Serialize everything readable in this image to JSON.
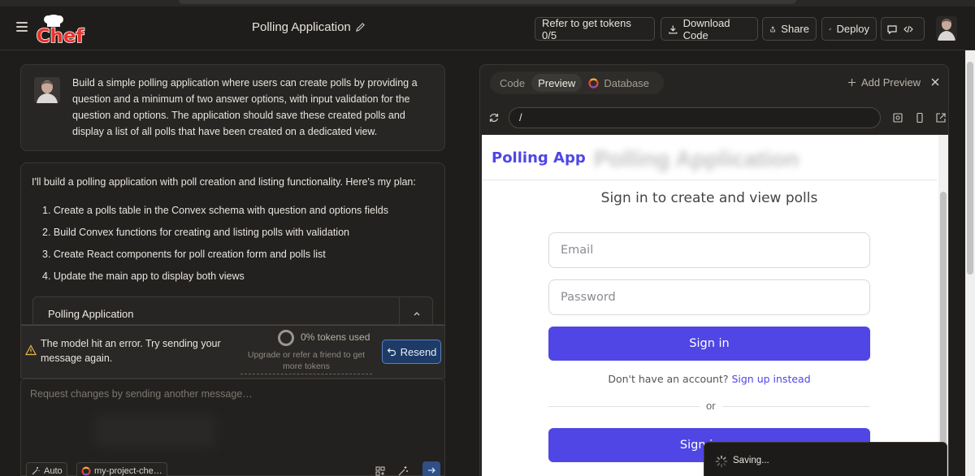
{
  "header": {
    "logo_text": "Chef",
    "project_title": "Polling Application",
    "refer_label": "Refer to get tokens 0/5",
    "download_label": "Download Code",
    "share_label": "Share",
    "deploy_label": "Deploy"
  },
  "chat": {
    "user_prompt": "Build a simple polling application where users can create polls by providing a question and a minimum of two answer options, with input validation for the question and options. The application should save these created polls and display a list of all polls that have been created on a dedicated view.",
    "assistant_intro": "I'll build a polling application with poll creation and listing functionality. Here's my plan:",
    "plan": [
      "1. Create a polls table in the Convex schema with question and options fields",
      "2. Build Convex functions for creating and listing polls with validation",
      "3. Create React components for poll creation form and polls list",
      "4. Update the main app to display both views"
    ],
    "artifact_title": "Polling Application"
  },
  "error": {
    "message": "The model hit an error. Try sending your message again.",
    "tokens_used": "0% tokens used",
    "upgrade_text": "Upgrade or refer a friend to get more tokens",
    "resend_label": "Resend"
  },
  "composer": {
    "placeholder": "Request changes by sending another message…",
    "mode_label": "Auto",
    "project_label": "my-project-che…"
  },
  "preview": {
    "tabs": [
      "Code",
      "Preview",
      "Database"
    ],
    "active_tab": "Preview",
    "add_preview_label": "Add Preview",
    "url": "/",
    "app": {
      "brand": "Polling App",
      "blurred_title": "Polling Application",
      "subtitle": "Sign in to create and view polls",
      "email_placeholder": "Email",
      "password_placeholder": "Password",
      "sign_in_label": "Sign in",
      "no_account_text": "Don't have an account?",
      "sign_up_link": "Sign up instead",
      "or_text": "or",
      "anon_label_visible": "Sign in an"
    }
  },
  "toast": {
    "text": "Saving..."
  },
  "colors": {
    "accent": "#4f46e5",
    "logo_red": "#e8322b",
    "resend_bg": "#1e3a66"
  }
}
